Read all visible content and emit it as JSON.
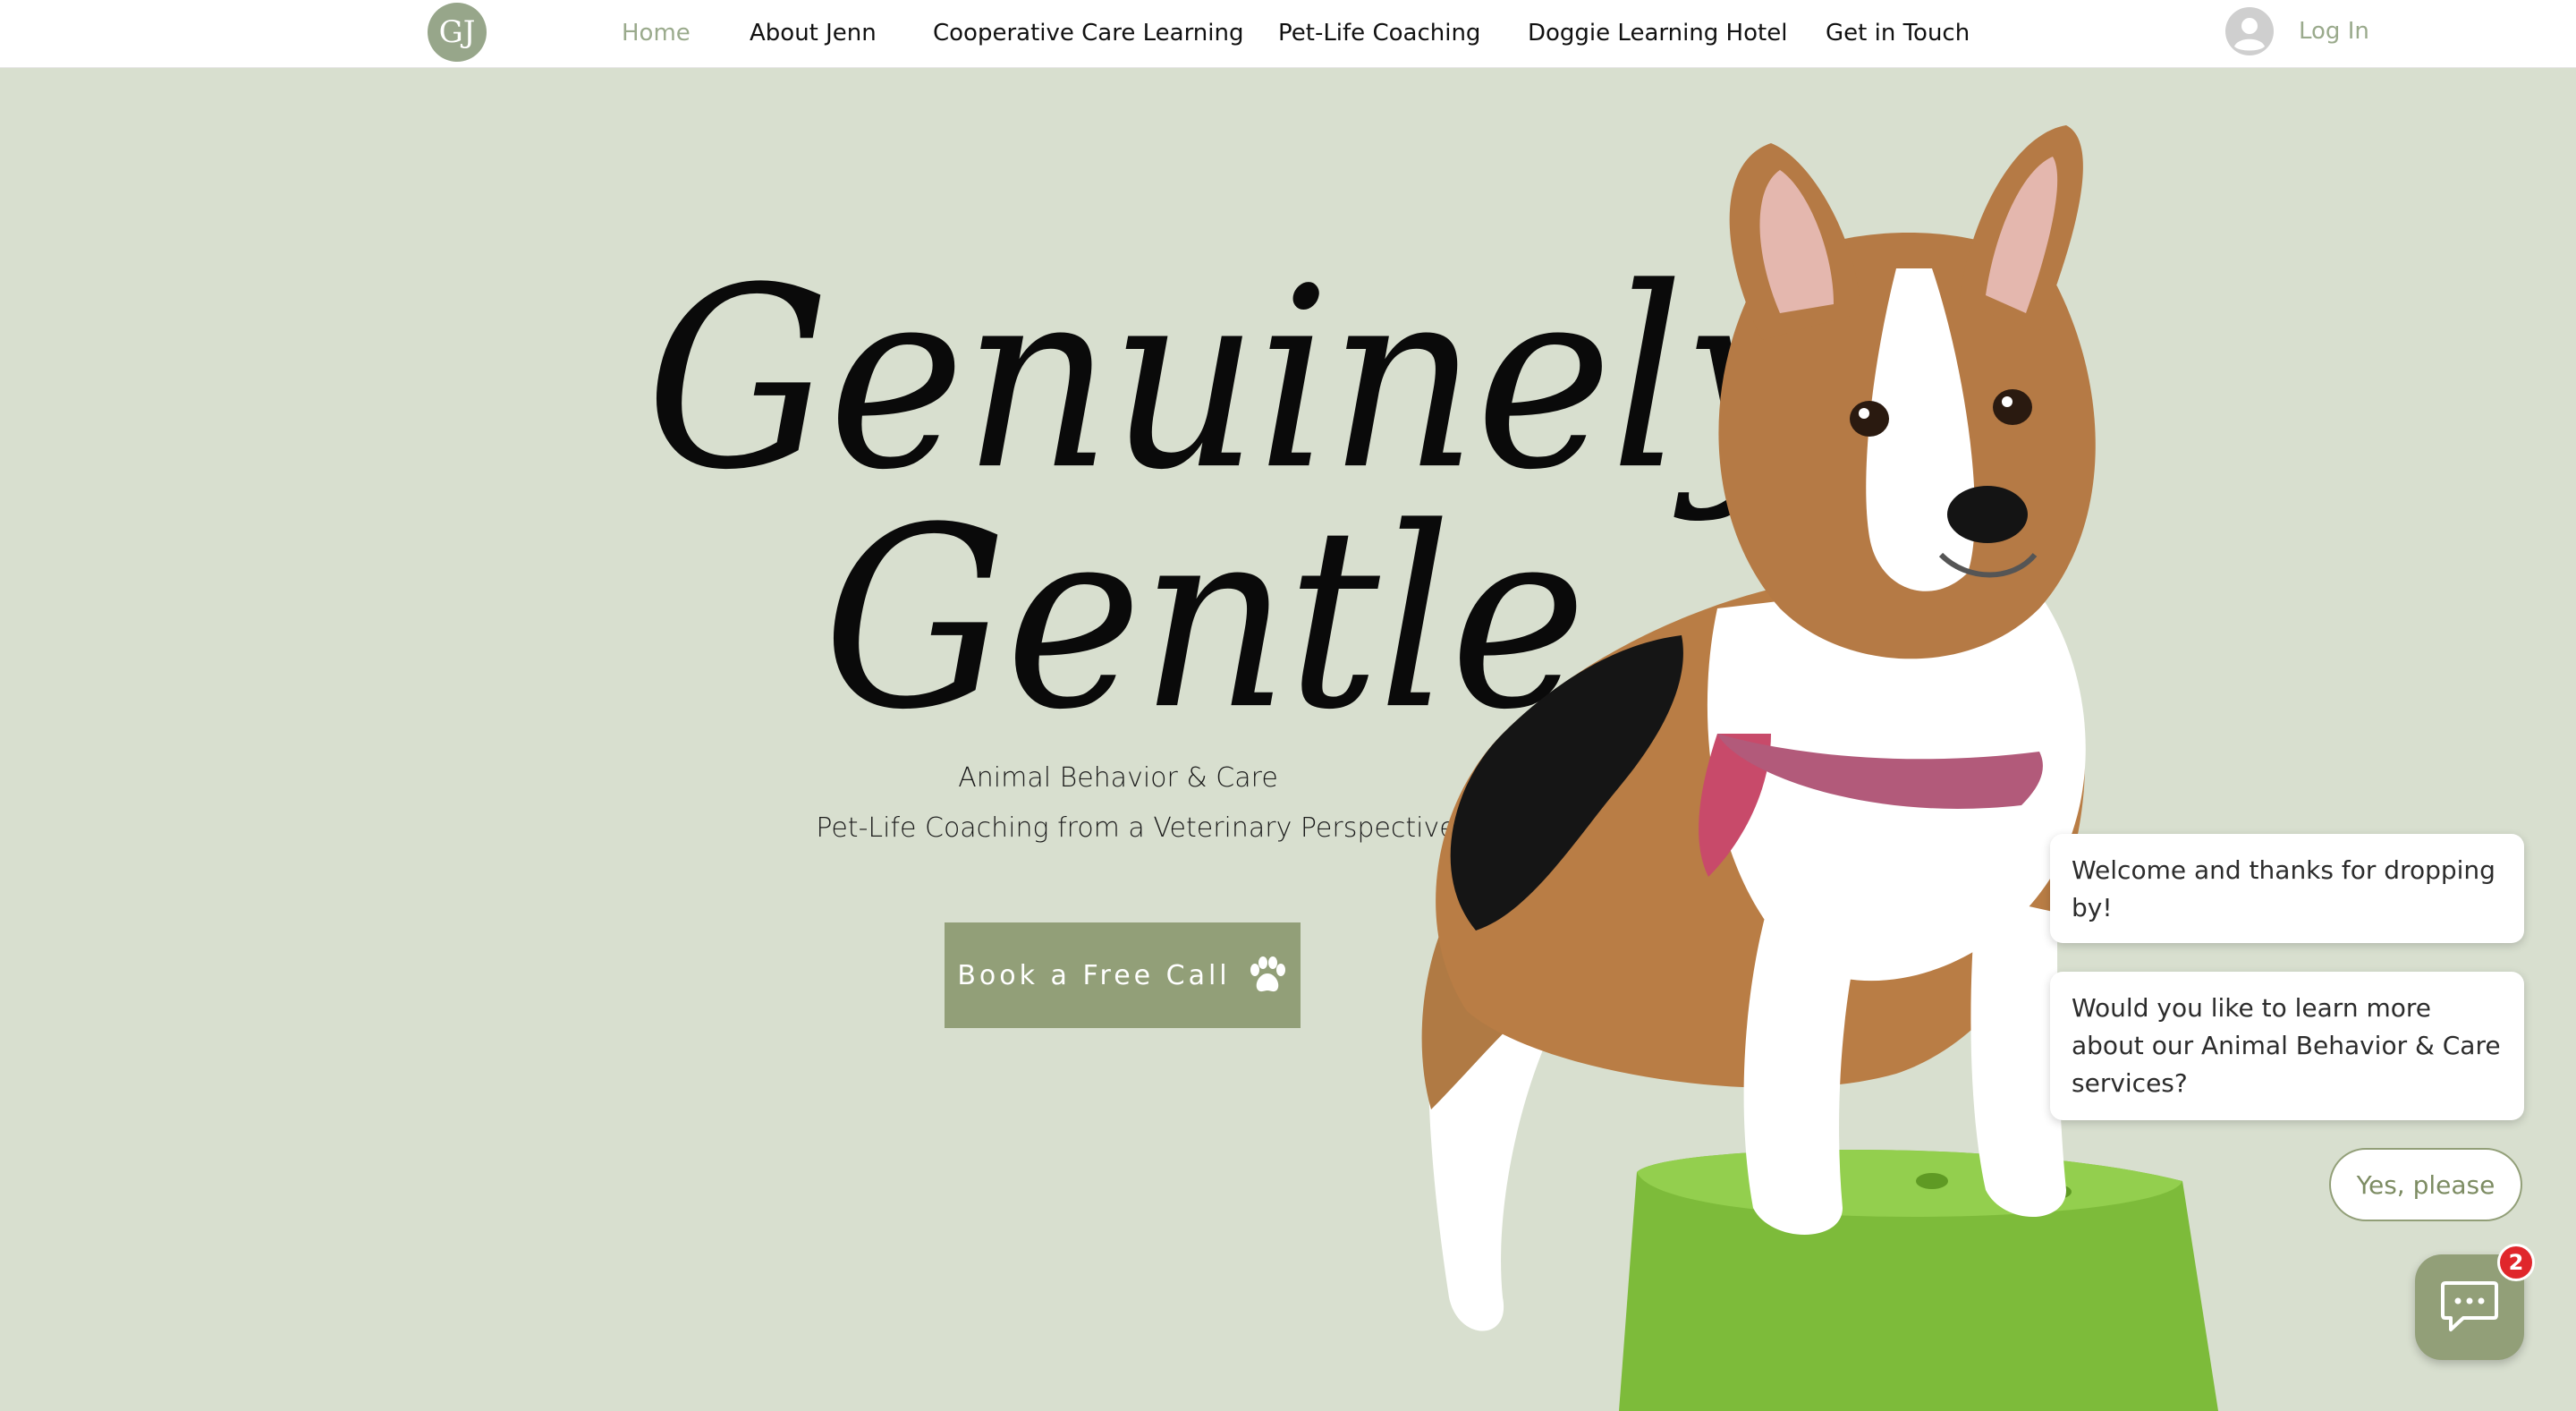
{
  "header": {
    "logo_text": "GJ",
    "nav": [
      {
        "label": "Home",
        "active": true
      },
      {
        "label": "About Jenn",
        "active": false
      },
      {
        "label": "Cooperative Care Learning",
        "active": false
      },
      {
        "label": "Pet-Life Coaching",
        "active": false
      },
      {
        "label": "Doggie Learning Hotel",
        "active": false
      },
      {
        "label": "Get in Touch",
        "active": false
      }
    ],
    "login_label": "Log In",
    "login_icon": "user-avatar-icon"
  },
  "hero": {
    "title_line_1": "Genuinely",
    "title_line_2": "Gentle",
    "subtitle_1": "Animal Behavior & Care",
    "subtitle_2": "Pet-Life Coaching from a Veterinary Perspective",
    "cta_label": "Book a Free Call",
    "cta_icon": "paw-icon"
  },
  "chat": {
    "messages": [
      "Welcome and thanks for dropping by!",
      "Would you like to learn more about our Animal Behavior & Care services?"
    ],
    "reply_label": "Yes, please",
    "badge_count": "2",
    "launcher_icon": "chat-icon"
  },
  "colors": {
    "page_background": "#d8dfcf",
    "accent": "#929f78",
    "active_nav": "#9aaa8c",
    "badge": "#e0262b",
    "stool": "#7dbb3a"
  }
}
